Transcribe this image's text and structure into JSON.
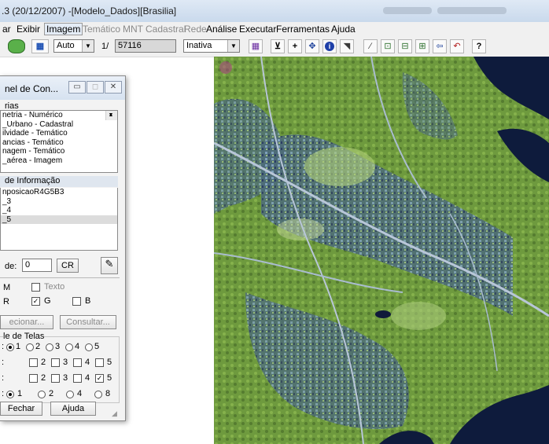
{
  "window": {
    "title": ".3 (20/12/2007) -[Modelo_Dados][Brasilia]"
  },
  "menu": [
    {
      "label": "ar",
      "enabled": true
    },
    {
      "label": "Exibir",
      "enabled": true
    },
    {
      "label": "Imagem",
      "enabled": true
    },
    {
      "label": "Temático",
      "enabled": false
    },
    {
      "label": "MNT",
      "enabled": false
    },
    {
      "label": "Cadastral",
      "enabled": false
    },
    {
      "label": "Rede",
      "enabled": false
    },
    {
      "label": "Análise",
      "enabled": true
    },
    {
      "label": "Executar",
      "enabled": true
    },
    {
      "label": "Ferramentas",
      "enabled": true
    },
    {
      "label": "Ajuda",
      "enabled": true
    }
  ],
  "toolbar": {
    "zoom_mode": "Auto",
    "scale_prefix": "1/",
    "scale_value": "57116",
    "state_value": "Inativa"
  },
  "panel": {
    "title": "nel de Con...",
    "categories_label": "rias",
    "categories": [
      "netria - Numérico",
      "_Urbano - Cadastral",
      "ilvidade - Temático",
      "ancias - Temático",
      "nagem - Temático",
      "_aérea - Imagem"
    ],
    "info_label": "de Informação",
    "info_planes": [
      "nposicaoR4G5B3",
      "_3",
      "_4",
      "_5"
    ],
    "priority_label": "de:",
    "priority_value": "0",
    "cr_label": "CR",
    "texto_label": "Texto",
    "m_label": "M",
    "r_label": "R",
    "g_label": "G",
    "b_label": "B",
    "select_button": "ecionar...",
    "query_button": "Consultar...",
    "screens_label": "le de Telas",
    "screen_options": [
      "1",
      "2",
      "3",
      "4",
      "5"
    ],
    "row2_options": [
      "2",
      "3",
      "4",
      "5"
    ],
    "row3_options": [
      "2",
      "3",
      "4",
      "5"
    ],
    "row4_options": [
      "1",
      "2",
      "4",
      "8"
    ],
    "close_button": "Fechar",
    "help_button": "Ajuda"
  },
  "colors": {
    "accent_blue": "#3b5fa0",
    "panel_bg": "#f3f3f3",
    "toolbar_bg": "#f0f0f0",
    "water": "#0e1b3c"
  }
}
